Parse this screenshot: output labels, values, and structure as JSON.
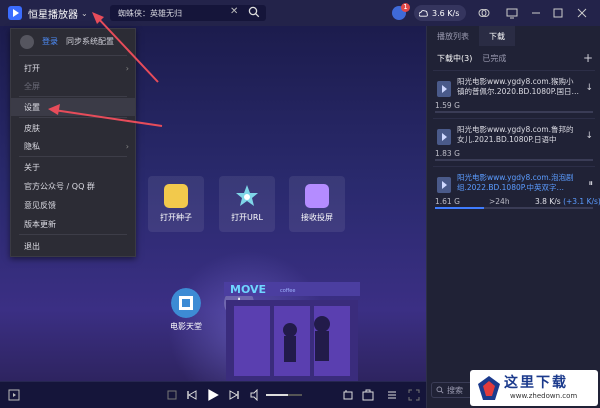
{
  "app": {
    "name": "恒星播放器"
  },
  "search": {
    "value": "蜘蛛侠：英雄无归"
  },
  "header": {
    "speed": "3.6 K/s",
    "notify_count": "1"
  },
  "menu": {
    "login": "登录",
    "sync": "同步系统配置",
    "items": [
      {
        "label": "打开",
        "has_sub": true,
        "disabled": false
      },
      {
        "label": "全屏",
        "has_sub": false,
        "disabled": true
      },
      {
        "label": "设置",
        "has_sub": false,
        "disabled": false,
        "highlighted": true
      },
      {
        "label": "皮肤",
        "has_sub": false,
        "disabled": false
      },
      {
        "label": "隐私",
        "has_sub": true,
        "disabled": false
      },
      {
        "label": "关于",
        "has_sub": false,
        "disabled": false
      },
      {
        "label": "官方公众号 / QQ 群",
        "has_sub": false,
        "disabled": false
      },
      {
        "label": "意见反馈",
        "has_sub": false,
        "disabled": false
      },
      {
        "label": "版本更新",
        "has_sub": false,
        "disabled": false
      },
      {
        "label": "退出",
        "has_sub": false,
        "disabled": false
      }
    ]
  },
  "actions": [
    {
      "label": "打开种子",
      "icon": "torrent-file-icon",
      "color": "#f2c94c"
    },
    {
      "label": "打开URL",
      "icon": "star-link-icon",
      "color": "#7fd6e8"
    },
    {
      "label": "接收投屏",
      "icon": "cast-screen-icon",
      "color": "#b48cff"
    }
  ],
  "quick": [
    {
      "label": "电影天堂",
      "icon": "film-icon"
    },
    {
      "label": "添加",
      "icon": "plus-icon"
    }
  ],
  "stage": {
    "shop_sign": "MOVE",
    "shop_sign_small": "coffee"
  },
  "panel": {
    "tabs": [
      "播放列表",
      "下载"
    ],
    "active_tab": 1,
    "sub_tabs": [
      "下载中(3)",
      "已完成"
    ],
    "downloads": [
      {
        "name": "阳光电影www.ygdy8.com.猴购小镇的普佩尔.2020.BD.1080P.国日…",
        "size": "1.59 G",
        "progress": 0,
        "active": false,
        "action": "download-icon"
      },
      {
        "name": "阳光电影www.ygdy8.com.鲁邦的女儿.2021.BD.1080P.日语中字.mkv",
        "size": "1.83 G",
        "progress": 0,
        "active": false,
        "action": "download-icon"
      },
      {
        "name": "阳光电影www.ygdy8.com.泡泡剧组.2022.BD.1080P.中英双字…",
        "size": "1.61 G",
        "eta": ">24h",
        "speed": "3.8 K/s",
        "speed_extra": "(+3.1 K/s)",
        "progress": 0.31,
        "active": true,
        "action": "pause-icon"
      }
    ],
    "search_placeholder": "搜索"
  },
  "watermark": {
    "text": "这里下载",
    "url": "www.zhedown.com"
  },
  "colors": {
    "accent": "#3f7cff",
    "link": "#4e8fff",
    "annotation_arrow": "#e74c5a"
  }
}
